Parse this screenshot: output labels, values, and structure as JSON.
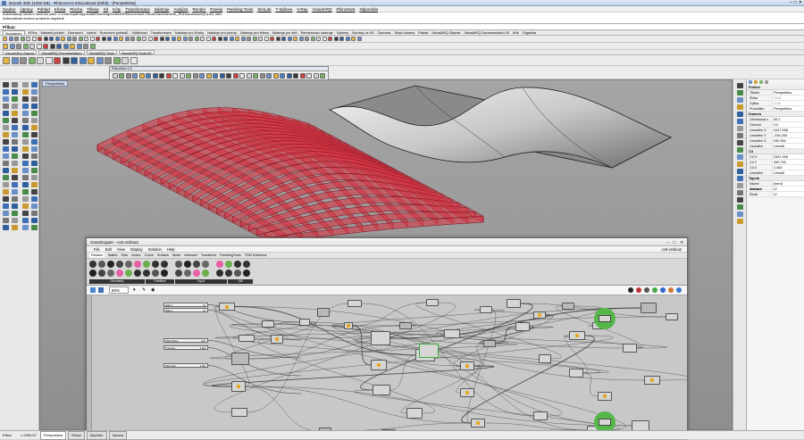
{
  "window": {
    "title": "lamonk 3dm (1452 KB) - Rhinoceros Educational (64bit) - [Perspektiva]",
    "min_label": "–",
    "max_label": "□",
    "close_label": "✕"
  },
  "menu": [
    "Soubor",
    "Úpravy",
    "Pohled",
    "Křivka",
    "Plocha",
    "Tělesa",
    "Sít",
    "Kóty",
    "Transformace",
    "Nástroje",
    "Analýza",
    "Render",
    "Panely",
    "Paneling Tools",
    "SimLab",
    "T-Splines",
    "V-Ray",
    "VisualARQ",
    "RhinoNest",
    "Nápověda"
  ],
  "command_history": [
    "Automatický uložení souboru jako: C:\\Users\\pan\\AppData\\Roaming\\McNeel\\Rhinoceros\\6.0\\AutoSave\\lamonk_RhinoAutosave(2)152) 3dm",
    "Automatické uložení proběhlo úspěšně"
  ],
  "command_prompt": "Příkaz:",
  "tabs_top": [
    "Standardní",
    "KPlov",
    "Nastavit pohled",
    "Zobrazení",
    "Vybrat",
    "Rozvržení pohledů",
    "Viditelnost",
    "Transformace",
    "Nástroje pro Křivky",
    "Nástroje pro plochy",
    "Nástroje pro tělesa",
    "Nástroje pro sítě",
    "Renderovací nástroje",
    "Výkresy",
    "Novinky ve V6",
    "Zarovnat",
    "Skrýt clustery",
    "Paleta",
    "VisualARQ Objects",
    "VisualARQ Documentation 00",
    "Křtk",
    "Organika"
  ],
  "tabs_second": [
    "VisualARQ Objects",
    "VisualARQ Documentation",
    "VisualARQ Tools",
    "VisualARQ Tools 00"
  ],
  "viewport": {
    "label": "Perspektiva",
    "floating_toolbar_title": "RhinoNest 2.0"
  },
  "properties": {
    "sec_view": "Pohled",
    "rows_view": [
      {
        "k": "Titulek",
        "v": "Perspektiva",
        "dim": false
      },
      {
        "k": "Šířka",
        "v": "2006",
        "dim": true
      },
      {
        "k": "Výška",
        "v": "1146",
        "dim": true
      },
      {
        "k": "Promítání",
        "v": "Perspektiva",
        "dim": false
      }
    ],
    "sec_camera": "Kamera",
    "rows_camera": [
      {
        "k": "Ohnisková v.",
        "v": "50.0",
        "dim": false
      },
      {
        "k": "Otočení",
        "v": "0.0",
        "dim": false
      },
      {
        "k": "Umístění X",
        "v": "3437.558",
        "dim": false
      },
      {
        "k": "Umístění Y",
        "v": "-339.253",
        "dim": false
      },
      {
        "k": "Umístění Z",
        "v": "530.984",
        "dim": false
      },
      {
        "k": "Umístění",
        "v": "Umístit",
        "dim": false
      }
    ],
    "sec_target": "Cíl",
    "rows_target": [
      {
        "k": "Cíl X",
        "v": "2591.308",
        "dim": false
      },
      {
        "k": "Cíl Y",
        "v": "399.759",
        "dim": false
      },
      {
        "k": "Cíl Z",
        "v": "2.463",
        "dim": false
      },
      {
        "k": "Umístění",
        "v": "Umístit",
        "dim": false
      }
    ],
    "sec_wallpaper": "Tapeta",
    "rows_wallpaper": [
      {
        "k": "Název souboru",
        "v": "(není)",
        "dim": false
      },
      {
        "k": "Zobrazit",
        "v": "☑",
        "dim": false
      },
      {
        "k": "Šedá",
        "v": "☑",
        "dim": false
      }
    ]
  },
  "grasshopper": {
    "title": "Grasshopper - cv5-vzdina2",
    "doc_name": "cv5-vzdina2",
    "menu": [
      "File",
      "Edit",
      "View",
      "Display",
      "Solution",
      "Help"
    ],
    "tabs": [
      "Params",
      "Maths",
      "Sets",
      "Vector",
      "Curve",
      "Surface",
      "Mesh",
      "Intersect",
      "Transform",
      "PanelingTools",
      "TSM Solutions"
    ],
    "ribbon_groups": [
      "Geometry",
      "Primitive",
      "Input",
      "Util"
    ],
    "zoom": "80%",
    "sliders": [
      {
        "label": "Slider 1",
        "value": "24"
      },
      {
        "label": "Slider 2",
        "value": "10"
      },
      {
        "label": "Width Param",
        "value": "0.00"
      },
      {
        "label": "Thickness",
        "value": "4.200"
      },
      {
        "label": "Offset Dist",
        "value": "0.000"
      }
    ]
  },
  "status": [
    "Křtlov",
    "x 2054.67",
    "y 1411.18",
    "z 0.00"
  ],
  "viewtabs": [
    "Perspektiva",
    "Shora",
    "Zepředu",
    "Zprava"
  ]
}
